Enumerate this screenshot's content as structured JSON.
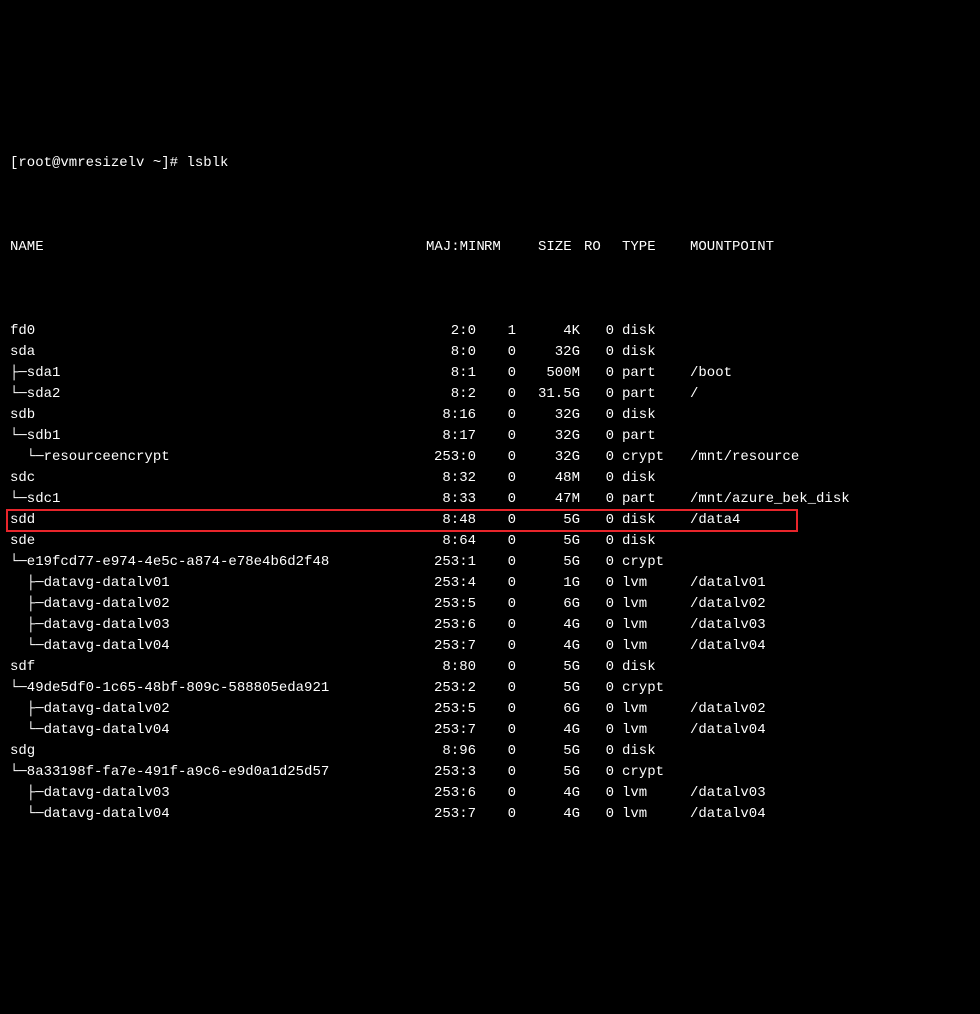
{
  "prompt": "[root@vmresizelv ~]# ",
  "command": "lsblk",
  "headers": {
    "name": "NAME",
    "majmin": "MAJ:MIN",
    "rm": "RM",
    "size": "SIZE",
    "ro": "RO",
    "type": "TYPE",
    "mountpoint": "MOUNTPOINT"
  },
  "rows": [
    {
      "name": "fd0",
      "majmin": "2:0",
      "rm": "1",
      "size": "4K",
      "ro": "0",
      "type": "disk",
      "mountpoint": "",
      "highlight": false
    },
    {
      "name": "sda",
      "majmin": "8:0",
      "rm": "0",
      "size": "32G",
      "ro": "0",
      "type": "disk",
      "mountpoint": "",
      "highlight": false
    },
    {
      "name": "├─sda1",
      "majmin": "8:1",
      "rm": "0",
      "size": "500M",
      "ro": "0",
      "type": "part",
      "mountpoint": "/boot",
      "highlight": false
    },
    {
      "name": "└─sda2",
      "majmin": "8:2",
      "rm": "0",
      "size": "31.5G",
      "ro": "0",
      "type": "part",
      "mountpoint": "/",
      "highlight": false
    },
    {
      "name": "sdb",
      "majmin": "8:16",
      "rm": "0",
      "size": "32G",
      "ro": "0",
      "type": "disk",
      "mountpoint": "",
      "highlight": false
    },
    {
      "name": "└─sdb1",
      "majmin": "8:17",
      "rm": "0",
      "size": "32G",
      "ro": "0",
      "type": "part",
      "mountpoint": "",
      "highlight": false
    },
    {
      "name": "  └─resourceencrypt",
      "majmin": "253:0",
      "rm": "0",
      "size": "32G",
      "ro": "0",
      "type": "crypt",
      "mountpoint": "/mnt/resource",
      "highlight": false
    },
    {
      "name": "sdc",
      "majmin": "8:32",
      "rm": "0",
      "size": "48M",
      "ro": "0",
      "type": "disk",
      "mountpoint": "",
      "highlight": false
    },
    {
      "name": "└─sdc1",
      "majmin": "8:33",
      "rm": "0",
      "size": "47M",
      "ro": "0",
      "type": "part",
      "mountpoint": "/mnt/azure_bek_disk",
      "highlight": false
    },
    {
      "name": "sdd",
      "majmin": "8:48",
      "rm": "0",
      "size": "5G",
      "ro": "0",
      "type": "disk",
      "mountpoint": "/data4",
      "highlight": true
    },
    {
      "name": "sde",
      "majmin": "8:64",
      "rm": "0",
      "size": "5G",
      "ro": "0",
      "type": "disk",
      "mountpoint": "",
      "highlight": false
    },
    {
      "name": "└─e19fcd77-e974-4e5c-a874-e78e4b6d2f48",
      "majmin": "253:1",
      "rm": "0",
      "size": "5G",
      "ro": "0",
      "type": "crypt",
      "mountpoint": "",
      "highlight": false
    },
    {
      "name": "  ├─datavg-datalv01",
      "majmin": "253:4",
      "rm": "0",
      "size": "1G",
      "ro": "0",
      "type": "lvm",
      "mountpoint": "/datalv01",
      "highlight": false
    },
    {
      "name": "  ├─datavg-datalv02",
      "majmin": "253:5",
      "rm": "0",
      "size": "6G",
      "ro": "0",
      "type": "lvm",
      "mountpoint": "/datalv02",
      "highlight": false
    },
    {
      "name": "  ├─datavg-datalv03",
      "majmin": "253:6",
      "rm": "0",
      "size": "4G",
      "ro": "0",
      "type": "lvm",
      "mountpoint": "/datalv03",
      "highlight": false
    },
    {
      "name": "  └─datavg-datalv04",
      "majmin": "253:7",
      "rm": "0",
      "size": "4G",
      "ro": "0",
      "type": "lvm",
      "mountpoint": "/datalv04",
      "highlight": false
    },
    {
      "name": "sdf",
      "majmin": "8:80",
      "rm": "0",
      "size": "5G",
      "ro": "0",
      "type": "disk",
      "mountpoint": "",
      "highlight": false
    },
    {
      "name": "└─49de5df0-1c65-48bf-809c-588805eda921",
      "majmin": "253:2",
      "rm": "0",
      "size": "5G",
      "ro": "0",
      "type": "crypt",
      "mountpoint": "",
      "highlight": false
    },
    {
      "name": "  ├─datavg-datalv02",
      "majmin": "253:5",
      "rm": "0",
      "size": "6G",
      "ro": "0",
      "type": "lvm",
      "mountpoint": "/datalv02",
      "highlight": false
    },
    {
      "name": "  └─datavg-datalv04",
      "majmin": "253:7",
      "rm": "0",
      "size": "4G",
      "ro": "0",
      "type": "lvm",
      "mountpoint": "/datalv04",
      "highlight": false
    },
    {
      "name": "sdg",
      "majmin": "8:96",
      "rm": "0",
      "size": "5G",
      "ro": "0",
      "type": "disk",
      "mountpoint": "",
      "highlight": false
    },
    {
      "name": "└─8a33198f-fa7e-491f-a9c6-e9d0a1d25d57",
      "majmin": "253:3",
      "rm": "0",
      "size": "5G",
      "ro": "0",
      "type": "crypt",
      "mountpoint": "",
      "highlight": false
    },
    {
      "name": "  ├─datavg-datalv03",
      "majmin": "253:6",
      "rm": "0",
      "size": "4G",
      "ro": "0",
      "type": "lvm",
      "mountpoint": "/datalv03",
      "highlight": false
    },
    {
      "name": "  └─datavg-datalv04",
      "majmin": "253:7",
      "rm": "0",
      "size": "4G",
      "ro": "0",
      "type": "lvm",
      "mountpoint": "/datalv04",
      "highlight": false
    }
  ],
  "hdr_pad": {
    "name_w": 388
  }
}
